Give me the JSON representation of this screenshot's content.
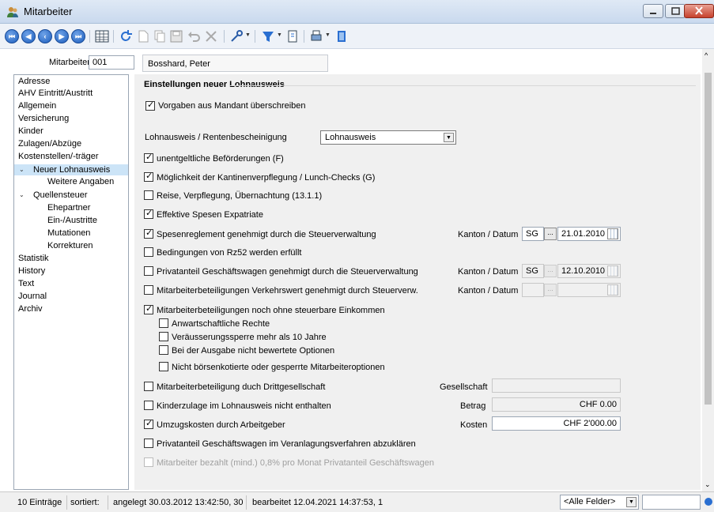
{
  "window": {
    "title": "Mitarbeiter"
  },
  "header": {
    "label": "Mitarbeiter",
    "id": "001",
    "name": "Bosshard, Peter"
  },
  "sidebar": {
    "items": [
      {
        "label": "Adresse"
      },
      {
        "label": "AHV Eintritt/Austritt"
      },
      {
        "label": "Allgemein"
      },
      {
        "label": "Versicherung"
      },
      {
        "label": "Kinder"
      },
      {
        "label": "Zulagen/Abzüge"
      },
      {
        "label": "Kostenstellen/-träger"
      },
      {
        "label": "Neuer Lohnausweis",
        "selected": true
      },
      {
        "label": "Weitere Angaben"
      },
      {
        "label": "Quellensteuer"
      },
      {
        "label": "Ehepartner"
      },
      {
        "label": "Ein-/Austritte"
      },
      {
        "label": "Mutationen"
      },
      {
        "label": "Korrekturen"
      },
      {
        "label": "Statistik"
      },
      {
        "label": "History"
      },
      {
        "label": "Text"
      },
      {
        "label": "Journal"
      },
      {
        "label": "Archiv"
      }
    ]
  },
  "main": {
    "section_title": "Einstellungen neuer Lohnausweis",
    "override": {
      "label": "Vorgaben aus Mandant überschreiben",
      "checked": true
    },
    "type_label": "Lohnausweis / Rentenbescheinigung",
    "type_value": "Lohnausweis",
    "options": [
      {
        "label": "unentgeltliche Beförderungen (F)",
        "checked": true
      },
      {
        "label": "Möglichkeit der Kantinenverpflegung / Lunch-Checks (G)",
        "checked": true
      },
      {
        "label": "Reise, Verpflegung, Übernachtung (13.1.1)",
        "checked": false
      },
      {
        "label": "Effektive Spesen Expatriate",
        "checked": true
      },
      {
        "label": "Spesenreglement genehmigt durch die Steuerverwaltung",
        "checked": true
      },
      {
        "label": "Bedingungen von Rz52 werden erfüllt",
        "checked": false
      },
      {
        "label": "Privatanteil Geschäftswagen genehmigt durch die Steuerverwaltung",
        "checked": false
      },
      {
        "label": "Mitarbeiterbeteiligungen Verkehrswert genehmigt  durch Steuerverw.",
        "checked": false
      },
      {
        "label": "Mitarbeiterbeteiligungen noch ohne steuerbare Einkommen",
        "checked": true
      }
    ],
    "sub_options": [
      {
        "label": "Anwartschaftliche Rechte",
        "checked": false
      },
      {
        "label": "Veräusserungssperre mehr als 10 Jahre",
        "checked": false
      },
      {
        "label": "Bei der Ausgabe nicht bewertete Optionen",
        "checked": false
      },
      {
        "label": "Nicht börsenkotierte oder gesperrte Mitarbeiteroptionen",
        "checked": false
      }
    ],
    "lower_options": [
      {
        "label": "Mitarbeiterbeteiligung duch Drittgesellschaft",
        "checked": false
      },
      {
        "label": "Kinderzulage im Lohnausweis nicht enthalten",
        "checked": false
      },
      {
        "label": "Umzugskosten durch Arbeitgeber",
        "checked": true
      },
      {
        "label": "Privatanteil Geschäftswagen im Veranlagungsverfahren abzuklären",
        "checked": false
      },
      {
        "label": "Mitarbeiter bezahlt (mind.) 0,8% pro Monat Privatanteil Geschäftswagen",
        "checked": false,
        "disabled": true
      }
    ],
    "kanton_label": "Kanton / Datum",
    "spesen": {
      "kanton": "SG",
      "date": "21.01.2010"
    },
    "privat": {
      "kanton": "SG",
      "date": "12.10.2010"
    },
    "verkehr": {
      "kanton": "",
      "date": ""
    },
    "dots": "...",
    "gesellschaft_label": "Gesellschaft",
    "gesellschaft_value": "",
    "betrag_label": "Betrag",
    "betrag_value": "CHF 0.00",
    "kosten_label": "Kosten",
    "kosten_value": "CHF 2'000.00"
  },
  "status": {
    "count": "10 Einträge",
    "sorted": "sortiert:",
    "created": "angelegt 30.03.2012 13:42:50, 30",
    "edited": "bearbeitet 12.04.2021 14:37:53, 1",
    "filter": "<Alle Felder>"
  },
  "colors": {
    "selection": "#cce4f7",
    "accent": "#1c5dbd"
  }
}
